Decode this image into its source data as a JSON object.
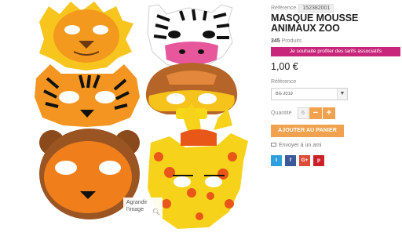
{
  "gallery": {
    "zoom_line1": "Agrandir",
    "zoom_line2": "l'image",
    "zoom_icon": "magnifier-icon",
    "masks": [
      "lion",
      "zebra",
      "tiger",
      "monkey",
      "bear",
      "giraffe"
    ]
  },
  "product": {
    "reference_label": "Référence",
    "reference_value": "152382001",
    "title": "MASQUE MOUSSE ANIMAUX ZOO",
    "count_value": "345",
    "count_label": "Produits",
    "promo_text": "Je souhaite profiter des tarifs associatifs",
    "price": "1,00 €",
    "reference_select_label": "Référence",
    "reference_select_value": "BG 2019",
    "quantity_label": "Quantité",
    "quantity_value": "6",
    "minus": "−",
    "plus": "+",
    "add_to_cart": "AJOUTER AU PANIER",
    "send_friend": "Envoyer à un ami"
  },
  "social": {
    "twitter": "t",
    "facebook": "f",
    "googleplus": "G+",
    "pinterest": "p"
  },
  "colors": {
    "promo_bg": "#c8267b",
    "button_orange": "#f0a24f",
    "twitter": "#2fa0df",
    "facebook": "#3b5998",
    "googleplus": "#dd4b39",
    "pinterest": "#cb2027"
  }
}
